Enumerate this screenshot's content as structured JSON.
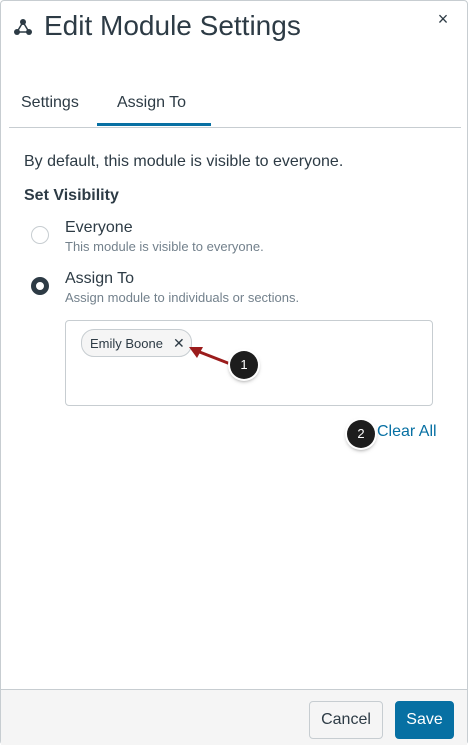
{
  "header": {
    "icon": "modules-icon",
    "title": "Edit Module Settings",
    "close_label": "×"
  },
  "tabs": [
    {
      "label": "Settings",
      "active": false
    },
    {
      "label": "Assign To",
      "active": true
    }
  ],
  "body": {
    "description": "By default, this module is visible to everyone.",
    "section_label": "Set Visibility",
    "options": [
      {
        "label": "Everyone",
        "sublabel": "This module is visible to everyone.",
        "selected": false
      },
      {
        "label": "Assign To",
        "sublabel": "Assign module to individuals or sections.",
        "selected": true
      }
    ],
    "assignees": [
      {
        "name": "Emily Boone",
        "remove_label": "✕"
      }
    ],
    "clear_all_label": "Clear All"
  },
  "callouts": [
    "1",
    "2"
  ],
  "footer": {
    "cancel_label": "Cancel",
    "save_label": "Save"
  },
  "colors": {
    "accent": "#0770a3",
    "text": "#2d3b45",
    "arrow": "#9b1c1c",
    "callout": "#1d1d1d"
  }
}
